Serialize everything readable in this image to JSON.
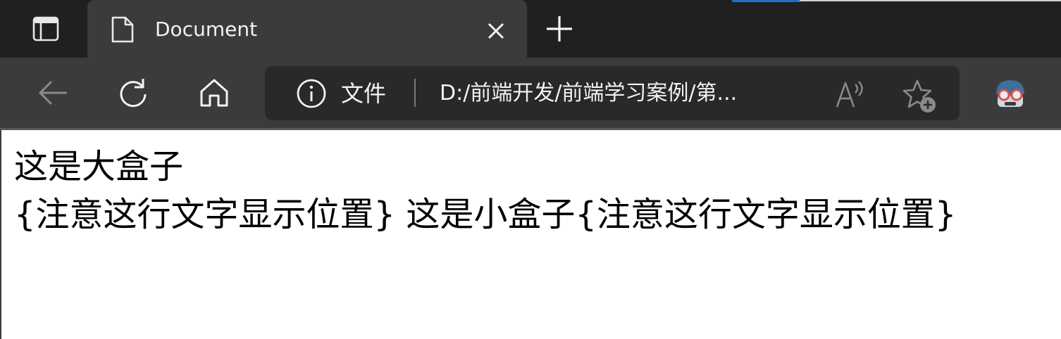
{
  "tab": {
    "title": "Document"
  },
  "toolbar": {
    "site_info_label": "文件",
    "url": "D:/前端开发/前端学习案例/第..."
  },
  "page": {
    "big_box_text": "这是大盒子",
    "second_line": "{注意这行文字显示位置} 这是小盒子{注意这行文字显示位置}"
  },
  "icons": {
    "tab_actions": "tab-actions-icon",
    "favicon": "document-icon",
    "tab_close": "close-icon",
    "new_tab": "plus-icon",
    "back": "back-arrow-icon",
    "refresh": "refresh-icon",
    "home": "home-icon",
    "site_info": "info-icon",
    "read_aloud": "read-aloud-icon",
    "favorites": "star-add-icon",
    "profile": "profile-avatar-icon"
  },
  "colors": {
    "tabstrip_bg": "#202020",
    "toolbar_bg": "#3b3b3b",
    "addressbar_bg": "#292929",
    "accent": "#1a73c8"
  }
}
